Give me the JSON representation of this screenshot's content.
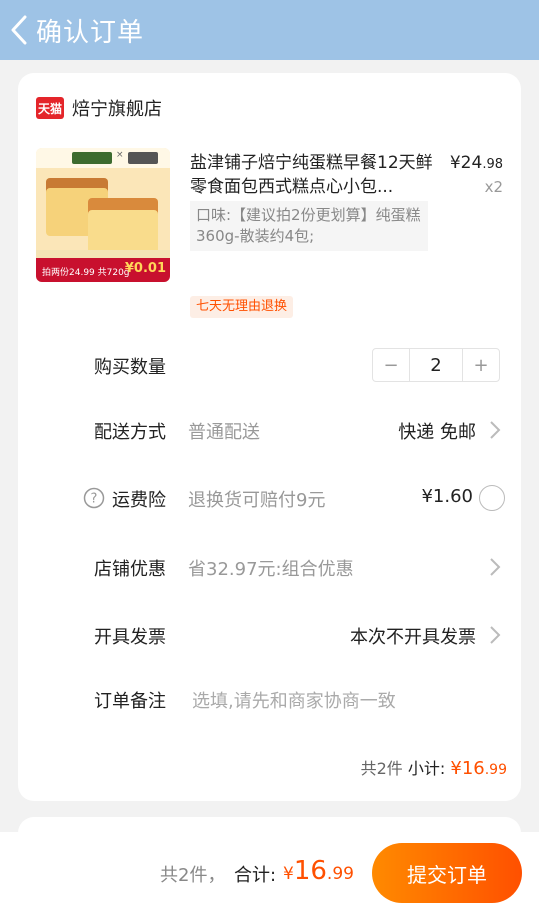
{
  "header": {
    "title": "确认订单"
  },
  "shop": {
    "badge": "天猫",
    "name": "焙宁旗舰店"
  },
  "product": {
    "title": "盐津铺子焙宁纯蛋糕早餐12天鲜零食面包西式糕点心小包...",
    "price_symbol": "¥",
    "price_int": "24",
    "price_dec": ".98",
    "quantity_text": "x2",
    "spec": "口味:【建议拍2份更划算】纯蛋糕360g-散装约4包;",
    "image_caption": "拍两份24.99 共720g",
    "image_price": "¥0.01",
    "return_tag": "七天无理由退换"
  },
  "order_fields": {
    "quantity": {
      "label": "购买数量",
      "minus": "−",
      "value": "2",
      "plus": "+"
    },
    "delivery": {
      "label": "配送方式",
      "value": "普通配送",
      "right": "快递 免邮"
    },
    "insurance": {
      "label": "运费险",
      "desc": "退换货可赔付9元",
      "price": "¥1.60"
    },
    "discount": {
      "label": "店铺优惠",
      "value": "省32.97元:组合优惠"
    },
    "invoice": {
      "label": "开具发票",
      "value": "本次不开具发票"
    },
    "note": {
      "label": "订单备注",
      "placeholder": "选填,请先和商家协商一致"
    }
  },
  "subtotal": {
    "count": "共2件",
    "label": "小计:",
    "symbol": "¥",
    "int": "16",
    "dec": ".99"
  },
  "footer": {
    "count": "共2件，",
    "label": "合计:",
    "symbol": "¥",
    "int": "16",
    "dec": ".99",
    "submit": "提交订单"
  },
  "colors": {
    "header": "#9ec3e6",
    "accent": "#ff5000",
    "tmall": "#e4252a"
  }
}
